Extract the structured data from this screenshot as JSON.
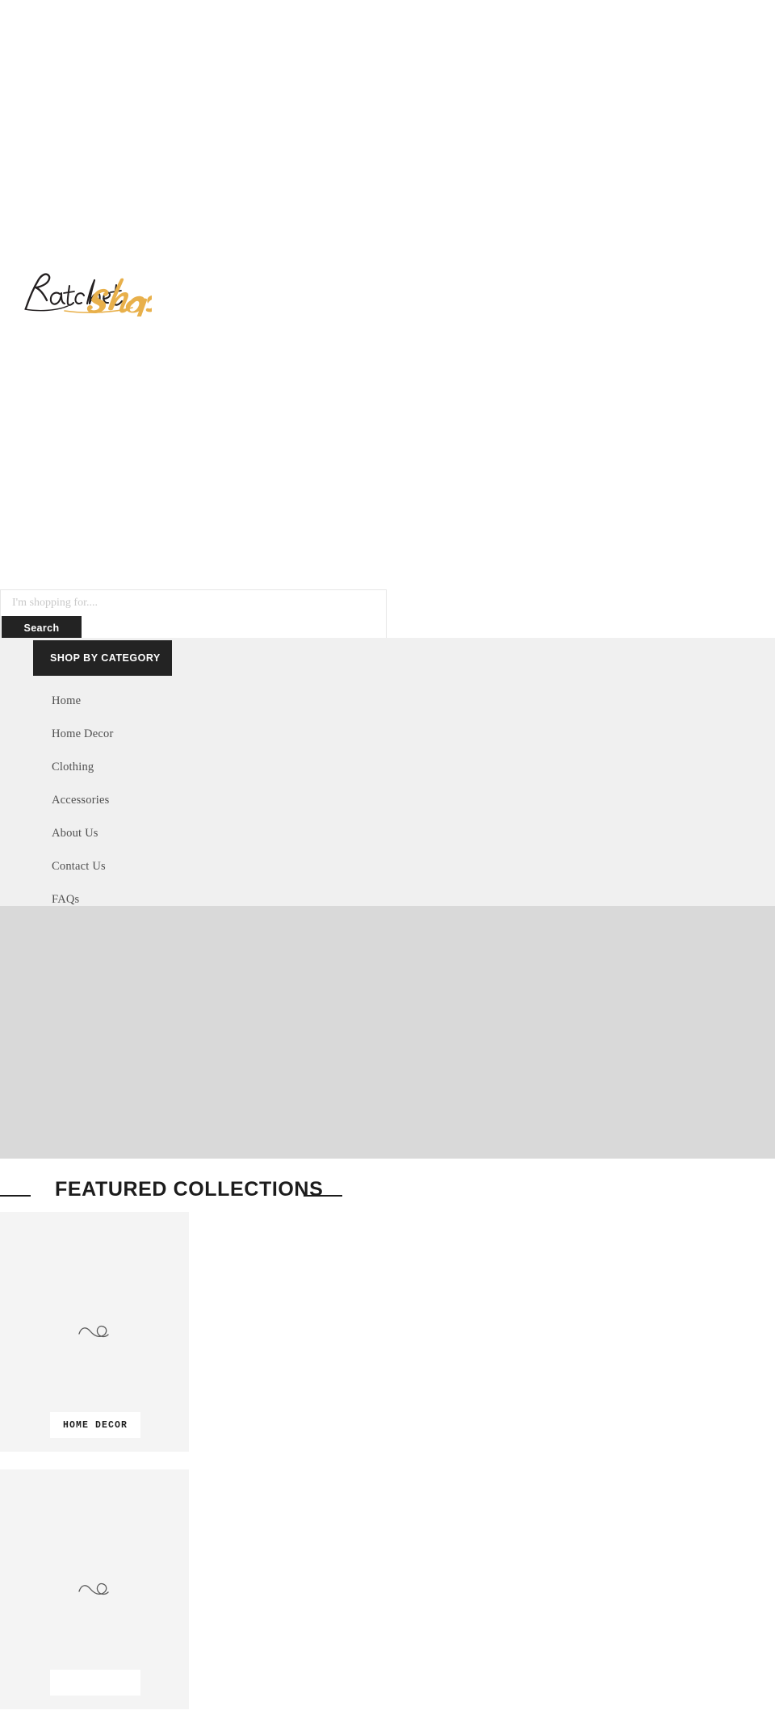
{
  "brand": {
    "name": "Ratchetshop",
    "script_part": "Ratchet",
    "bold_part": "shop",
    "script_color": "#231f20",
    "accent_color": "#e8b04b"
  },
  "search": {
    "placeholder": "I'm shopping for....",
    "value": "",
    "button_label": "Search"
  },
  "nav": {
    "category_button_label": "SHOP BY CATEGORY",
    "items": [
      {
        "label": "Home"
      },
      {
        "label": "Home Decor"
      },
      {
        "label": "Clothing"
      },
      {
        "label": "Accessories"
      },
      {
        "label": "About Us"
      },
      {
        "label": "Contact Us"
      },
      {
        "label": "FAQs"
      }
    ]
  },
  "hero": {
    "placeholder_color": "#d9d9d9"
  },
  "featured": {
    "heading": "FEATURED COLLECTIONS",
    "cards": [
      {
        "label": "HOME DECOR",
        "icon": "loading-spinner-icon"
      },
      {
        "label": "",
        "icon": "loading-spinner-icon"
      }
    ]
  },
  "colors": {
    "dark": "#232323",
    "nav_background": "#f0f0f0",
    "card_background": "#f4f4f4",
    "page_background": "#ffffff"
  }
}
